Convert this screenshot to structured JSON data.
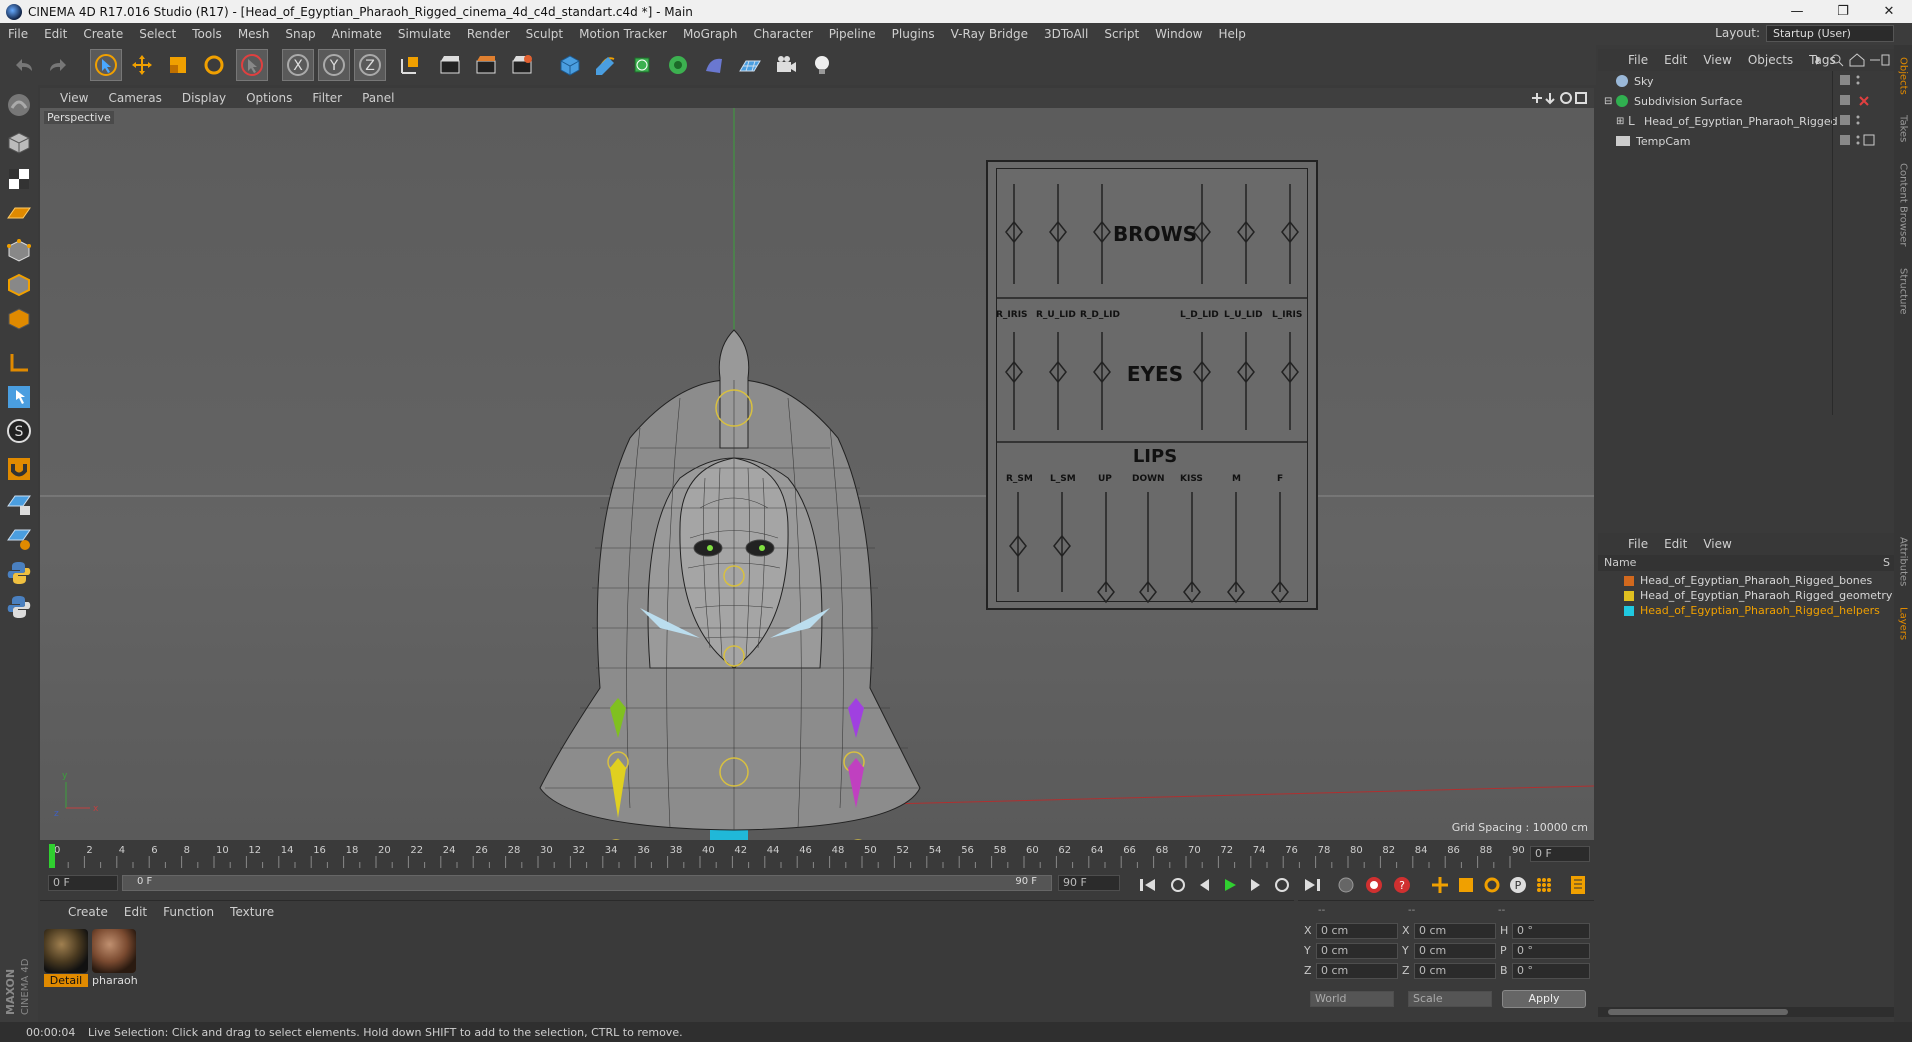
{
  "window": {
    "title": "CINEMA 4D R17.016 Studio (R17) - [Head_of_Egyptian_Pharaoh_Rigged_cinema_4d_c4d_standart.c4d *] - Main"
  },
  "menu": [
    "File",
    "Edit",
    "Create",
    "Select",
    "Tools",
    "Mesh",
    "Snap",
    "Animate",
    "Simulate",
    "Render",
    "Sculpt",
    "Motion Tracker",
    "MoGraph",
    "Character",
    "Pipeline",
    "Plugins",
    "V-Ray Bridge",
    "3DToAll",
    "Script",
    "Window",
    "Help"
  ],
  "layout": {
    "label": "Layout:",
    "value": "Startup (User)"
  },
  "viewport": {
    "menu": [
      "View",
      "Cameras",
      "Display",
      "Options",
      "Filter",
      "Panel"
    ],
    "camera_label": "Perspective",
    "grid_spacing": "Grid Spacing : 10000 cm",
    "rig_board": {
      "sections": [
        "BROWS",
        "EYES",
        "LIPS"
      ],
      "eye_labels": [
        "R_IRIS",
        "R_U_LID",
        "R_D_LID",
        "L_D_LID",
        "L_U_LID",
        "L_IRIS"
      ],
      "lip_labels": [
        "R_SM",
        "L_SM",
        "UP",
        "DOWN",
        "KISS",
        "M",
        "F"
      ]
    }
  },
  "timeline": {
    "ticks": [
      "0",
      "2",
      "4",
      "6",
      "8",
      "10",
      "12",
      "14",
      "16",
      "18",
      "20",
      "22",
      "24",
      "26",
      "28",
      "30",
      "32",
      "34",
      "36",
      "38",
      "40",
      "42",
      "44",
      "46",
      "48",
      "50",
      "52",
      "54",
      "56",
      "58",
      "60",
      "62",
      "64",
      "66",
      "68",
      "70",
      "72",
      "74",
      "76",
      "78",
      "80",
      "82",
      "84",
      "86",
      "88",
      "90"
    ],
    "current_frame": "0 F",
    "start_field": "0 F",
    "range_start": "0 F",
    "range_end": "90 F",
    "end_field": "90 F"
  },
  "materials": {
    "menu": [
      "Create",
      "Edit",
      "Function",
      "Texture"
    ],
    "items": [
      {
        "label": "Detail",
        "selected": true
      },
      {
        "label": "pharaoh",
        "selected": false
      }
    ]
  },
  "coordinates": {
    "header": [
      "--",
      "--",
      "--"
    ],
    "rows": [
      {
        "a": "X",
        "av": "0 cm",
        "b": "X",
        "bv": "0 cm",
        "c": "H",
        "cv": "0 °"
      },
      {
        "a": "Y",
        "av": "0 cm",
        "b": "Y",
        "bv": "0 cm",
        "c": "P",
        "cv": "0 °"
      },
      {
        "a": "Z",
        "av": "0 cm",
        "b": "Z",
        "bv": "0 cm",
        "c": "B",
        "cv": "0 °"
      }
    ],
    "mode1": "World",
    "mode2": "Scale",
    "apply": "Apply"
  },
  "status": {
    "time": "00:00:04",
    "message": "Live Selection: Click and drag to select elements. Hold down SHIFT to add to the selection, CTRL to remove."
  },
  "objects": {
    "menu": [
      "File",
      "Edit",
      "View",
      "Objects",
      "Tags"
    ],
    "items": [
      {
        "name": "Sky",
        "indent": 0
      },
      {
        "name": "Subdivision Surface",
        "indent": 0
      },
      {
        "name": "Head_of_Egyptian_Pharaoh_Rigged",
        "indent": 1
      },
      {
        "name": "TempCam",
        "indent": 0
      }
    ]
  },
  "layers": {
    "menu": [
      "File",
      "Edit",
      "View"
    ],
    "column_name": "Name",
    "column_s": "S",
    "items": [
      {
        "name": "Head_of_Egyptian_Pharaoh_Rigged_bones",
        "color": "#d2691e"
      },
      {
        "name": "Head_of_Egyptian_Pharaoh_Rigged_geometry",
        "color": "#e0c020"
      },
      {
        "name": "Head_of_Egyptian_Pharaoh_Rigged_helpers",
        "color": "#20c8e0"
      }
    ]
  },
  "side_tabs": [
    "Objects",
    "Takes",
    "Content Browser",
    "Structure",
    "Attributes",
    "Layers"
  ],
  "brand": "MAXON CINEMA 4D",
  "colors": {
    "accent": "#e08a00",
    "selection_orange": "#f0a000"
  }
}
